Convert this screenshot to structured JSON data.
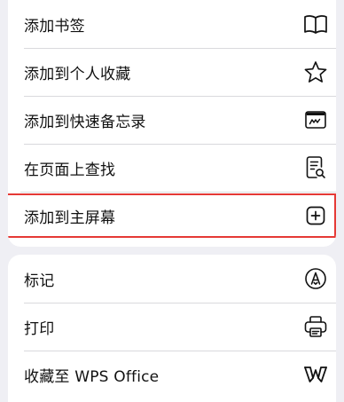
{
  "menu": {
    "group1": [
      {
        "label": "添加书签",
        "icon": "book-icon"
      },
      {
        "label": "添加到个人收藏",
        "icon": "star-icon"
      },
      {
        "label": "添加到快速备忘录",
        "icon": "quick-note-icon"
      },
      {
        "label": "在页面上查找",
        "icon": "find-on-page-icon"
      },
      {
        "label": "添加到主屏幕",
        "icon": "add-square-icon",
        "highlighted": true
      }
    ],
    "group2": [
      {
        "label": "标记",
        "icon": "markup-icon"
      },
      {
        "label": "打印",
        "icon": "printer-icon"
      },
      {
        "label": "收藏至 WPS Office",
        "icon": "wps-office-icon"
      }
    ]
  },
  "colors": {
    "background": "#efeff4",
    "card": "#ffffff",
    "text": "#111111",
    "separator": "#d9d9dd",
    "highlight_border": "#e53935"
  }
}
